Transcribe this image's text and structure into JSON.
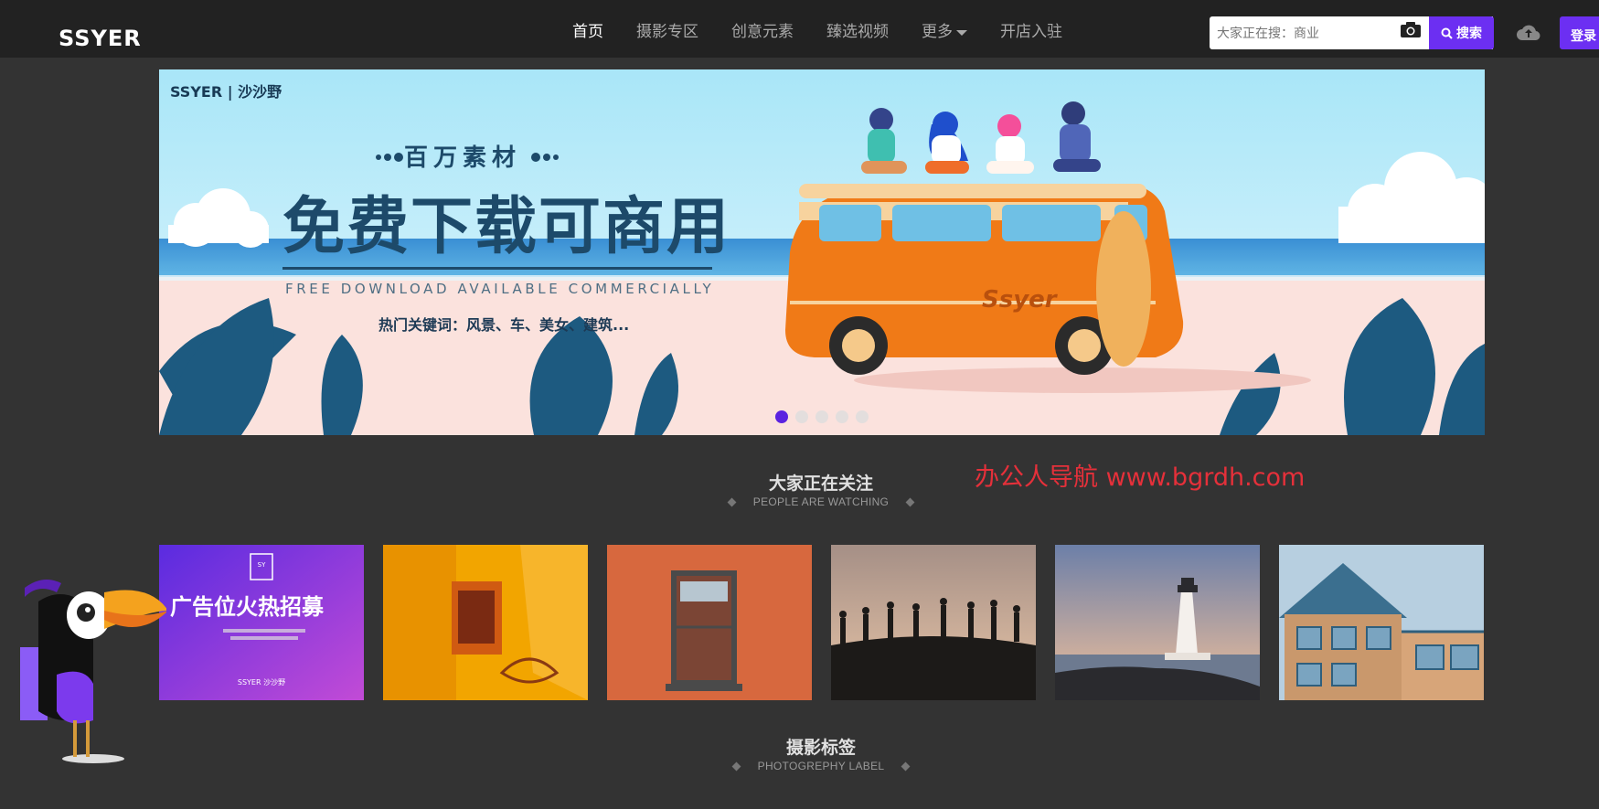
{
  "header": {
    "logo": "SSYER",
    "nav": [
      {
        "label": "首页",
        "active": true
      },
      {
        "label": "摄影专区"
      },
      {
        "label": "创意元素"
      },
      {
        "label": "臻选视频"
      },
      {
        "label": "更多"
      },
      {
        "label": "开店入驻"
      }
    ],
    "search_placeholder": "大家正在搜：商业",
    "search_button": "搜索",
    "login_button": "登录"
  },
  "banner": {
    "brand": "SSYER | 沙沙野",
    "kicker": "百万素材",
    "headline": "免费下载可商用",
    "english": "FREE DOWNLOAD AVAILABLE COMMERCIALLY",
    "keywords": "热门关键词：风景、车、美女、建筑...",
    "van_text": "Ssyer",
    "slides": 5,
    "active_slide": 1
  },
  "watching": {
    "title": "大家正在关注",
    "subtitle": "PEOPLE ARE WATCHING"
  },
  "watermark": "办公人导航 www.bgrdh.com",
  "thumbnails": [
    {
      "name": "ad-recruit",
      "text": "广告位火热招募",
      "small_brand": "SSYER 沙沙野"
    },
    {
      "name": "yellow-architecture"
    },
    {
      "name": "orange-window"
    },
    {
      "name": "silhouettes"
    },
    {
      "name": "lighthouse"
    },
    {
      "name": "wooden-house"
    }
  ],
  "photo_label": {
    "title": "摄影标签",
    "subtitle": "PHOTOGREPHY LABEL"
  },
  "colors": {
    "accent": "#6c2ff2",
    "bg": "#333333",
    "topbar": "#222222",
    "watermark": "#e5303a"
  }
}
